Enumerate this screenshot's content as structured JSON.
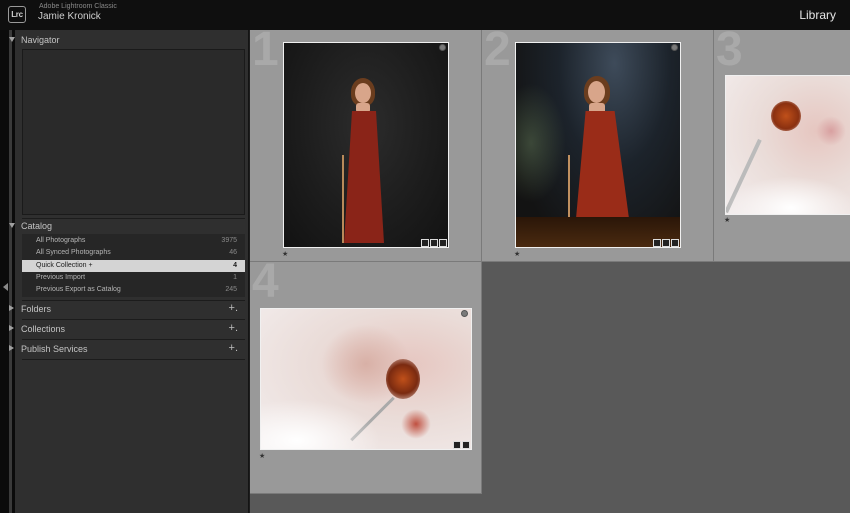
{
  "topbar": {
    "logo_text": "Lrc",
    "app_name": "Adobe Lightroom Classic",
    "user_name": "Jamie Kronick",
    "module": "Library"
  },
  "panels": {
    "navigator": {
      "label": "Navigator"
    },
    "catalog": {
      "label": "Catalog",
      "items": [
        {
          "name": "All Photographs",
          "count": "3975"
        },
        {
          "name": "All Synced Photographs",
          "count": "46"
        },
        {
          "name": "Quick Collection +",
          "count": "4"
        },
        {
          "name": "Previous Import",
          "count": "1"
        },
        {
          "name": "Previous Export as Catalog",
          "count": "245"
        }
      ]
    },
    "folders": {
      "label": "Folders",
      "plus": "+."
    },
    "collections": {
      "label": "Collections",
      "plus": "+."
    },
    "publish": {
      "label": "Publish Services",
      "plus": "+."
    }
  },
  "grid": {
    "cells": [
      {
        "index": "1",
        "star": "★"
      },
      {
        "index": "2",
        "star": "★"
      },
      {
        "index": "3",
        "star": "★"
      },
      {
        "index": "4",
        "star": "★"
      }
    ]
  }
}
